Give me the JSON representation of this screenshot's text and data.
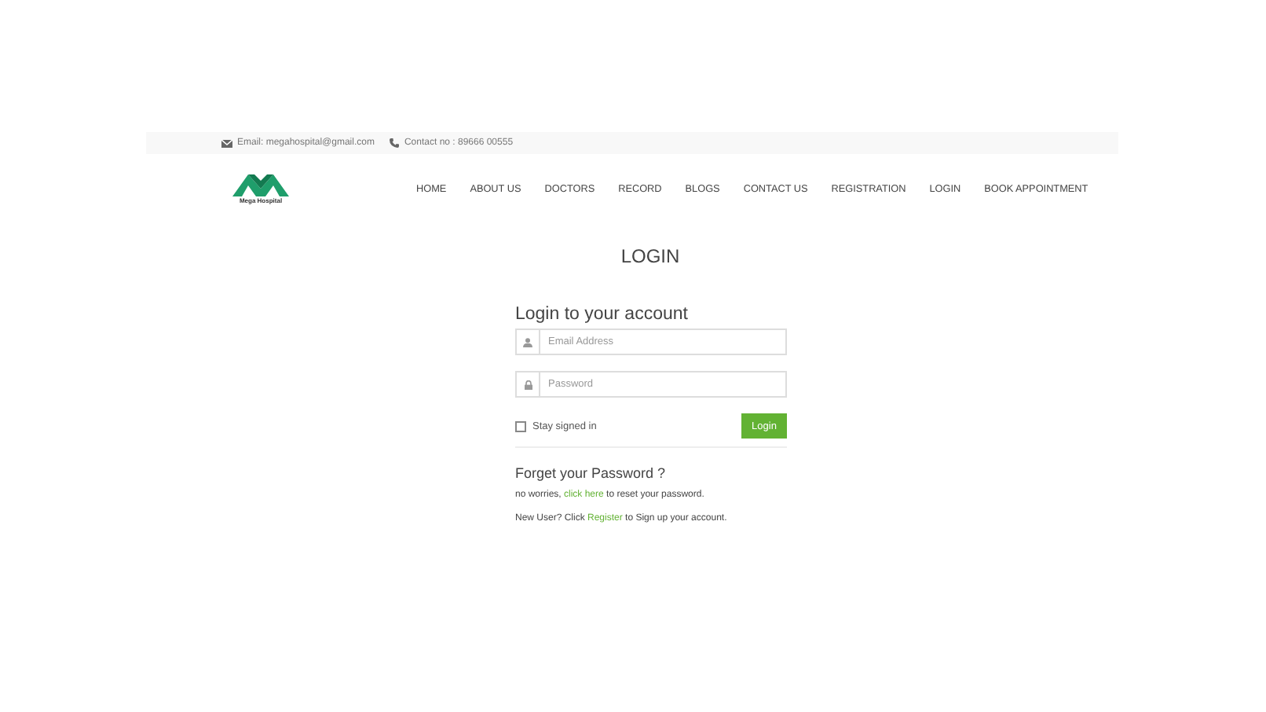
{
  "top_bar": {
    "email": "Email: megahospital@gmail.com",
    "contact": "Contact no : 89666 00555"
  },
  "logo": {
    "name": "Mega Hospital"
  },
  "nav": [
    {
      "label": "HOME"
    },
    {
      "label": "ABOUT US"
    },
    {
      "label": "DOCTORS"
    },
    {
      "label": "RECORD"
    },
    {
      "label": "BLOGS"
    },
    {
      "label": "CONTACT US"
    },
    {
      "label": "REGISTRATION"
    },
    {
      "label": "LOGIN"
    },
    {
      "label": "BOOK APPOINTMENT"
    }
  ],
  "page_title": "LOGIN",
  "form": {
    "heading": "Login to your account",
    "email": {
      "placeholder": "Email Address"
    },
    "password": {
      "placeholder": "Password"
    },
    "stay_signed_in": {
      "label": "Stay signed in",
      "checked": false
    },
    "button": "Login"
  },
  "forgot": {
    "heading": "Forget your Password ?",
    "lines": [
      {
        "before": "no worries, ",
        "link": "click here",
        "after": " to reset your password."
      },
      {
        "before": "New User? Click ",
        "link": "Register",
        "after": " to Sign up your account."
      }
    ]
  }
}
